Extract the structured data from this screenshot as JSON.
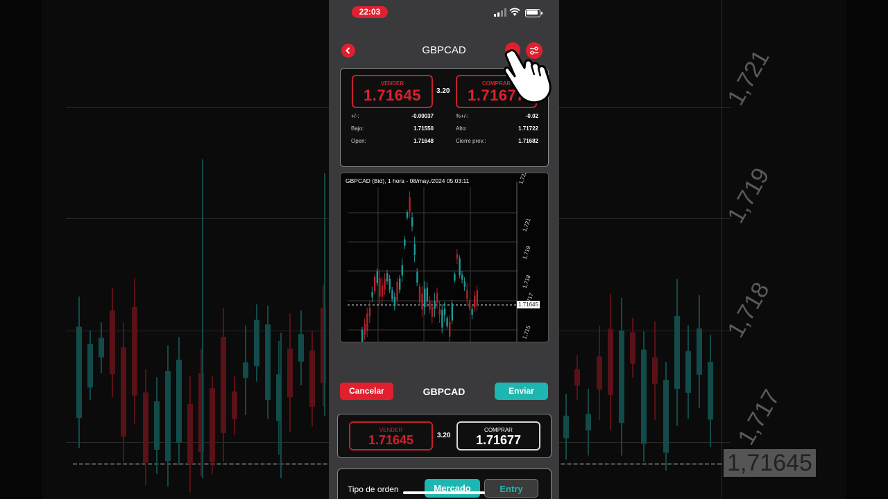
{
  "status_bar": {
    "time": "22:03"
  },
  "header": {
    "title": "GBPCAD"
  },
  "quote": {
    "sell_label": "VENDER",
    "sell_price": "1.71645",
    "buy_label": "COMPRAR",
    "buy_price": "1.71677",
    "spread": "3.20",
    "stats_left": [
      {
        "label": "+/-:",
        "value": "-0.00037"
      },
      {
        "label": "Bajo:",
        "value": "1.71550"
      },
      {
        "label": "Open:",
        "value": "1.71648"
      }
    ],
    "stats_right": [
      {
        "label": "%+/-:",
        "value": "-0.02"
      },
      {
        "label": "Alto:",
        "value": "1.71722"
      },
      {
        "label": "Cierre prev.:",
        "value": "1.71682"
      }
    ]
  },
  "chart": {
    "title": "GBPCAD (Bid), 1 hora - 08/may./2024 05:03:11",
    "price_tag": "1.71645",
    "y_ticks": [
      "1,722",
      "1,721",
      "1,719",
      "1,718",
      "1,717",
      "1,715"
    ]
  },
  "order": {
    "cancel_label": "Cancelar",
    "symbol": "GBPCAD",
    "send_label": "Enviar",
    "sell_label": "VENDER",
    "sell_price": "1.71645",
    "spread": "3.20",
    "buy_label": "COMPRAR",
    "buy_price": "1.71677",
    "type_label": "Tipo de orden",
    "type_options": [
      "Mercado",
      "Entry"
    ],
    "type_selected": "Mercado"
  },
  "background": {
    "y_labels": [
      "1,721",
      "1,719",
      "1,718",
      "1,717"
    ],
    "price_tag": "1,71645"
  },
  "colors": {
    "accent_red": "#e0202e",
    "accent_teal": "#1fb6b1",
    "candle_up": "#1e9a96",
    "candle_down": "#b3202b"
  }
}
